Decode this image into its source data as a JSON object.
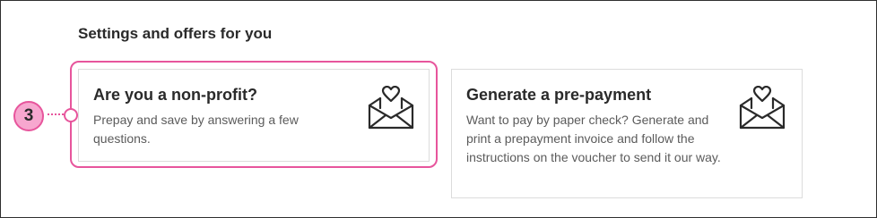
{
  "section": {
    "title": "Settings and offers for you"
  },
  "cards": [
    {
      "title": "Are you a non-profit?",
      "description": "Prepay and save by answering a few questions.",
      "icon": "envelope-heart-icon"
    },
    {
      "title": "Generate a pre-payment",
      "description": "Want to pay by paper check? Generate and print a prepayment invoice and follow the instructions on the voucher to send it our way.",
      "icon": "envelope-heart-icon"
    }
  ],
  "callout": {
    "number": "3",
    "color": "#e7559c",
    "fill": "#f7a7cf"
  }
}
